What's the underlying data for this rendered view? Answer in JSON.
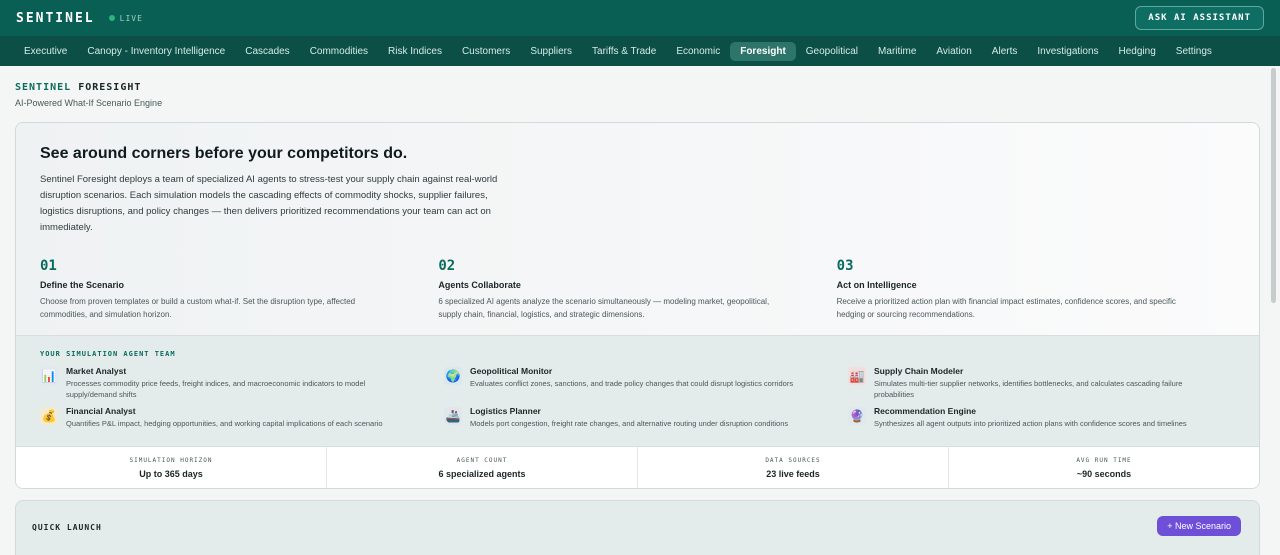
{
  "app": {
    "name": "SENTINEL",
    "live_label": "LIVE",
    "ask_button": "ASK AI ASSISTANT"
  },
  "nav": {
    "items": [
      "Executive",
      "Canopy - Inventory Intelligence",
      "Cascades",
      "Commodities",
      "Risk Indices",
      "Customers",
      "Suppliers",
      "Tariffs & Trade",
      "Economic",
      "Foresight",
      "Geopolitical",
      "Maritime",
      "Aviation",
      "Alerts",
      "Investigations",
      "Hedging",
      "Settings"
    ],
    "active": "Foresight"
  },
  "header": {
    "title_brand": "SENTINEL",
    "title_product": "FORESIGHT",
    "subtitle": "AI-Powered What-If Scenario Engine"
  },
  "hero": {
    "headline": "See around corners before your competitors do.",
    "description": "Sentinel Foresight deploys a team of specialized AI agents to stress-test your supply chain against real-world disruption scenarios. Each simulation models the cascading effects of commodity shocks, supplier failures, logistics disruptions, and policy changes — then delivers prioritized recommendations your team can act on immediately.",
    "steps": [
      {
        "num": "01",
        "title": "Define the Scenario",
        "desc": "Choose from proven templates or build a custom what-if. Set the disruption type, affected commodities, and simulation horizon."
      },
      {
        "num": "02",
        "title": "Agents Collaborate",
        "desc": "6 specialized AI agents analyze the scenario simultaneously — modeling market, geopolitical, supply chain, financial, logistics, and strategic dimensions."
      },
      {
        "num": "03",
        "title": "Act on Intelligence",
        "desc": "Receive a prioritized action plan with financial impact estimates, confidence scores, and specific hedging or sourcing recommendations."
      }
    ]
  },
  "agents": {
    "label": "YOUR SIMULATION AGENT TEAM",
    "items": [
      {
        "name": "Market Analyst",
        "desc": "Processes commodity price feeds, freight indices, and macroeconomic indicators to model supply/demand shifts",
        "icon": "bar-chart-icon",
        "glyph": "📊"
      },
      {
        "name": "Geopolitical Monitor",
        "desc": "Evaluates conflict zones, sanctions, and trade policy changes that could disrupt logistics corridors",
        "icon": "globe-icon",
        "glyph": "🌍"
      },
      {
        "name": "Supply Chain Modeler",
        "desc": "Simulates multi-tier supplier networks, identifies bottlenecks, and calculates cascading failure probabilities",
        "icon": "factory-icon",
        "glyph": "🏭"
      },
      {
        "name": "Financial Analyst",
        "desc": "Quantifies P&L impact, hedging opportunities, and working capital implications of each scenario",
        "icon": "money-bag-icon",
        "glyph": "💰"
      },
      {
        "name": "Logistics Planner",
        "desc": "Models port congestion, freight rate changes, and alternative routing under disruption conditions",
        "icon": "ship-icon",
        "glyph": "🚢"
      },
      {
        "name": "Recommendation Engine",
        "desc": "Synthesizes all agent outputs into prioritized action plans with confidence scores and timelines",
        "icon": "crystal-ball-icon",
        "glyph": "🔮"
      }
    ]
  },
  "stats": [
    {
      "label": "SIMULATION HORIZON",
      "value": "Up to 365 days"
    },
    {
      "label": "AGENT COUNT",
      "value": "6 specialized agents"
    },
    {
      "label": "DATA SOURCES",
      "value": "23 live feeds"
    },
    {
      "label": "AVG RUN TIME",
      "value": "~90 seconds"
    }
  ],
  "quick_launch": {
    "label": "QUICK LAUNCH",
    "new_button": "+ New Scenario"
  },
  "colors": {
    "topbar": "#0a5f55",
    "navbar": "#0b4f47",
    "accent": "#0a6b5e",
    "purple": "#6e4fd8"
  }
}
